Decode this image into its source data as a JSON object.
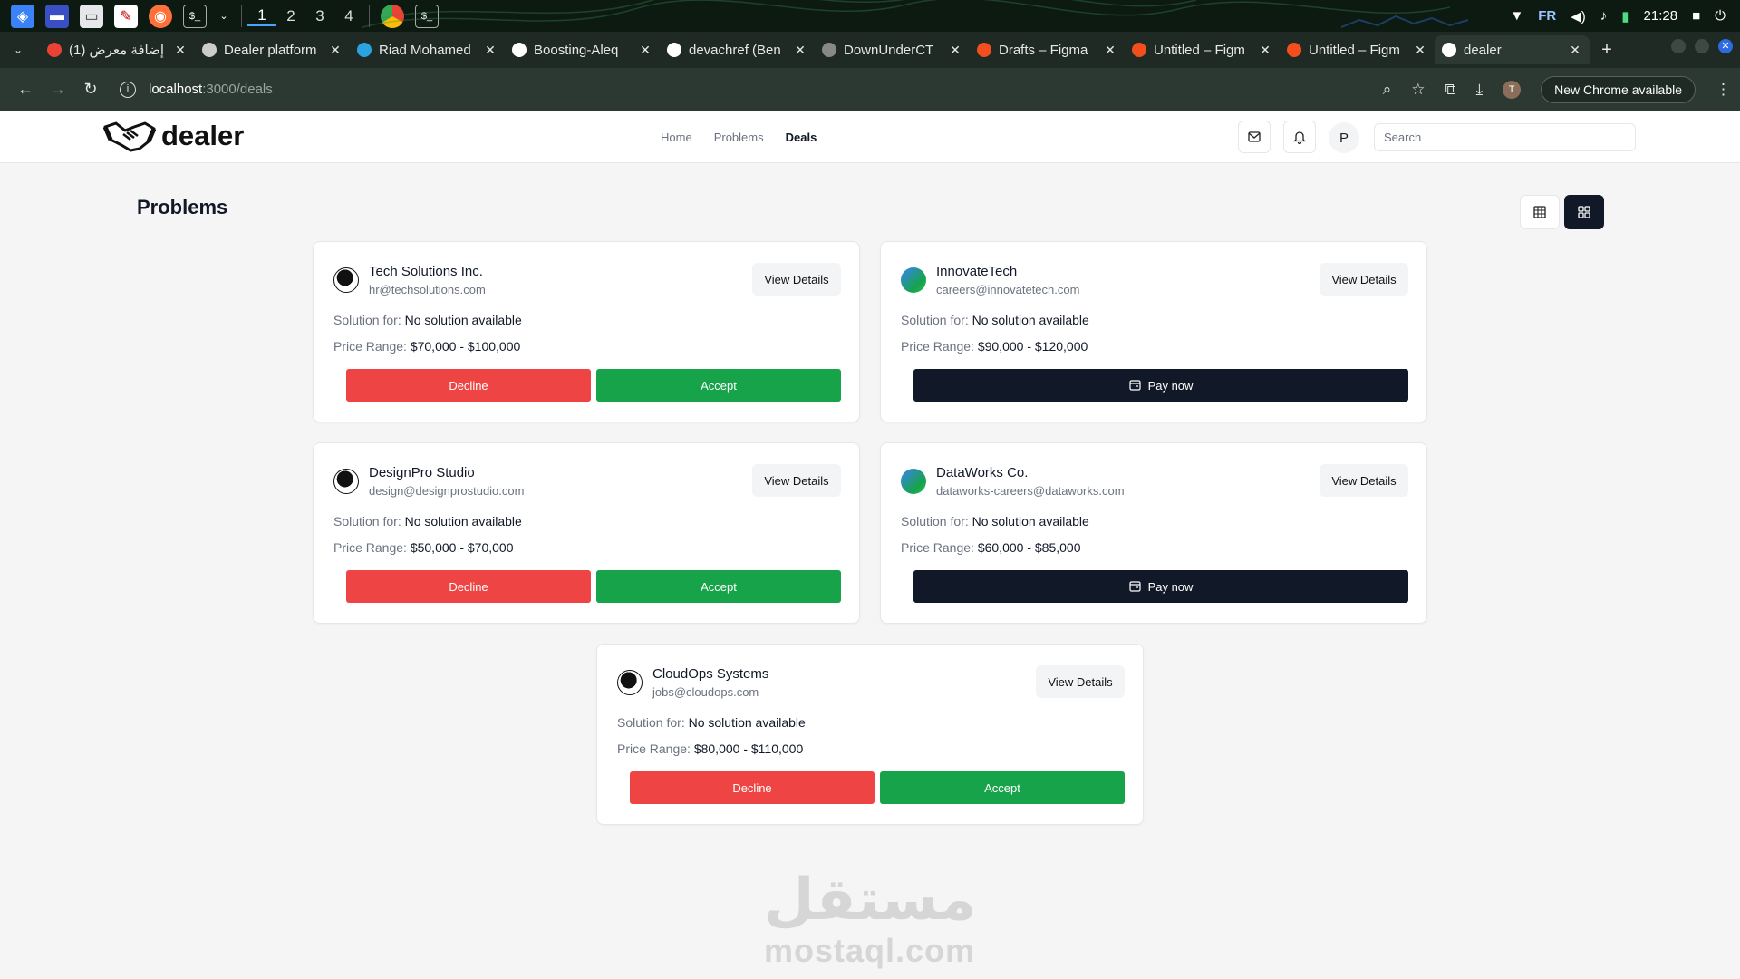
{
  "taskbar": {
    "workspaces": [
      "1",
      "2",
      "3",
      "4"
    ],
    "active_workspace": "1",
    "keyboard_layout": "FR",
    "clock": "21:28"
  },
  "browser": {
    "tabs": [
      {
        "label": "(1) إضافة معرض",
        "favicon_color": "#ea4335"
      },
      {
        "label": "Dealer platform",
        "favicon_color": "#cccccc"
      },
      {
        "label": "Riad Mohamed",
        "favicon_color": "#2aa3e0"
      },
      {
        "label": "Boosting-Aleq",
        "favicon_color": "#ffffff"
      },
      {
        "label": "devachref (Ben",
        "favicon_color": "#ffffff"
      },
      {
        "label": "DownUnderCT",
        "favicon_color": "#888888"
      },
      {
        "label": "Drafts – Figma",
        "favicon_color": "#f24e1e"
      },
      {
        "label": "Untitled – Figm",
        "favicon_color": "#f24e1e"
      },
      {
        "label": "Untitled – Figm",
        "favicon_color": "#f24e1e"
      },
      {
        "label": "dealer",
        "favicon_color": "#ffffff"
      }
    ],
    "active_tab_index": 9,
    "url_host": "localhost",
    "url_path": ":3000/deals",
    "profile_initial": "T",
    "update_label": "New Chrome available"
  },
  "header": {
    "brand": "dealer",
    "nav": [
      {
        "label": "Home",
        "active": false
      },
      {
        "label": "Problems",
        "active": false
      },
      {
        "label": "Deals",
        "active": true
      }
    ],
    "avatar_initial": "P",
    "search_placeholder": "Search"
  },
  "page": {
    "title": "Problems"
  },
  "labels": {
    "view_details": "View Details",
    "solution_for": "Solution for:",
    "price_range": "Price Range:",
    "decline": "Decline",
    "accept": "Accept",
    "pay_now": "Pay now"
  },
  "deals": [
    {
      "company": "Tech Solutions Inc.",
      "email": "hr@techsolutions.com",
      "solution": "No solution available",
      "price": "$70,000 - $100,000",
      "status": "pending",
      "logo": "person"
    },
    {
      "company": "InnovateTech",
      "email": "careers@innovatetech.com",
      "solution": "No solution available",
      "price": "$90,000 - $120,000",
      "status": "accepted",
      "logo": "gradient"
    },
    {
      "company": "DesignPro Studio",
      "email": "design@designprostudio.com",
      "solution": "No solution available",
      "price": "$50,000 - $70,000",
      "status": "pending",
      "logo": "person"
    },
    {
      "company": "DataWorks Co.",
      "email": "dataworks-careers@dataworks.com",
      "solution": "No solution available",
      "price": "$60,000 - $85,000",
      "status": "accepted",
      "logo": "gradient"
    },
    {
      "company": "CloudOps Systems",
      "email": "jobs@cloudops.com",
      "solution": "No solution available",
      "price": "$80,000 - $110,000",
      "status": "pending",
      "logo": "person"
    }
  ],
  "colors": {
    "decline": "#ef4444",
    "accept": "#16a34a",
    "pay": "#111827"
  },
  "watermark": {
    "arabic": "مستقل",
    "latin": "mostaql.com"
  }
}
